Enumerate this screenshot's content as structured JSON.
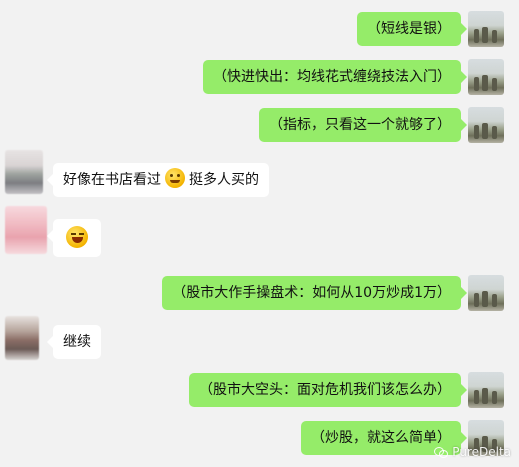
{
  "colors": {
    "background": "#f2f2f2",
    "sent_bubble": "#95ec69",
    "received_bubble": "#ffffff"
  },
  "messages": [
    {
      "side": "right",
      "text": "（短线是银）",
      "avatar": "user-photo"
    },
    {
      "side": "right",
      "text": "（快进快出：均线花式缠绕技法入门）",
      "avatar": "user-photo"
    },
    {
      "side": "right",
      "text": "（指标，只看这一个就够了）",
      "avatar": "user-photo"
    },
    {
      "side": "left",
      "text_before": "好像在书店看过",
      "emoji": "grin-emoji",
      "text_after": "挺多人买的",
      "avatar": "blurred"
    },
    {
      "side": "left",
      "emoji": "laughing-tears-emoji",
      "avatar": "blurred-pink"
    },
    {
      "side": "right",
      "text": "（股市大作手操盘术：如何从10万炒成1万）",
      "avatar": "user-photo"
    },
    {
      "side": "left",
      "text": "继续",
      "avatar": "blurred"
    },
    {
      "side": "right",
      "text": "（股市大空头：面对危机我们该怎么办）",
      "avatar": "user-photo"
    },
    {
      "side": "right",
      "text": "（炒股，就这么简单）",
      "avatar": "user-photo"
    }
  ],
  "watermark": "PureDelta"
}
